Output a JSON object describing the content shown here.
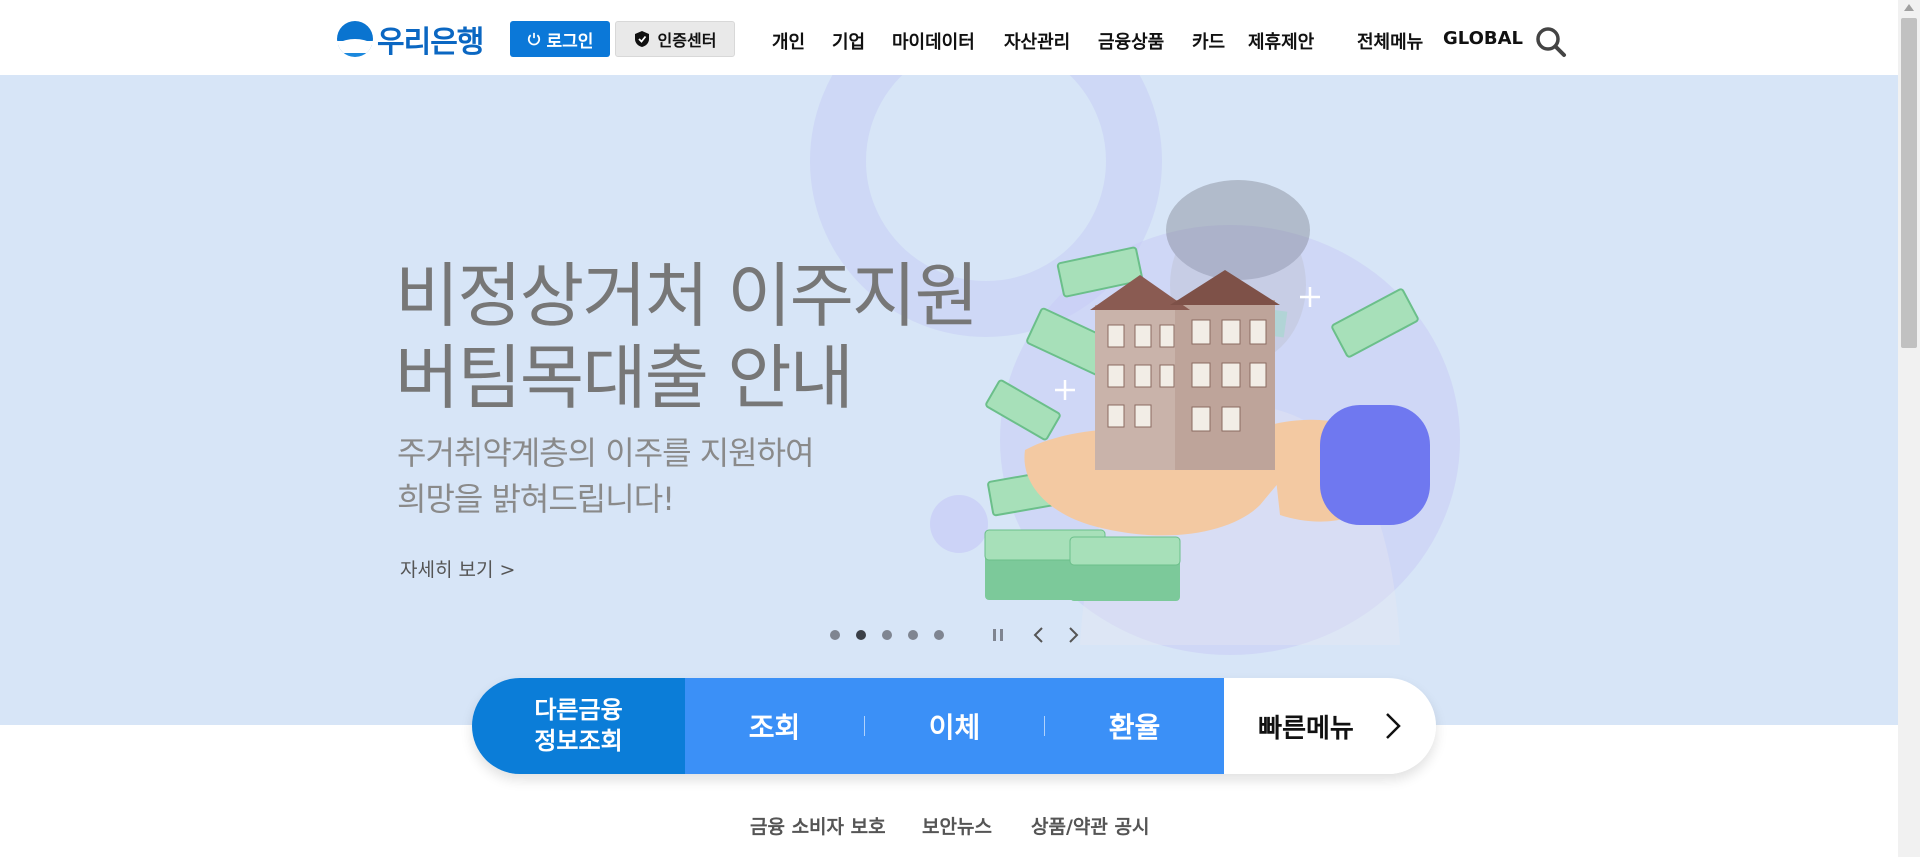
{
  "header": {
    "logo_text": "우리은행",
    "login_label": "로그인",
    "cert_label": "인증센터",
    "nav": [
      "개인",
      "기업",
      "마이데이터",
      "자산관리",
      "금융상품",
      "카드",
      "제휴제안"
    ],
    "all_menu": "전체메뉴",
    "global": "GLOBAL"
  },
  "hero": {
    "title_line1": "비정상거처 이주지원",
    "title_line2": "버팀목대출 안내",
    "subtitle_line1": "주거취약계층의 이주를 지원하여",
    "subtitle_line2": "희망을 밝혀드립니다!",
    "more_label": "자세히 보기 >",
    "slides_total": 5,
    "slide_active": 2
  },
  "quickbar": {
    "other_line1": "다른금융",
    "other_line2": "정보조회",
    "items": [
      "조회",
      "이체",
      "환율"
    ],
    "quick_menu": "빠른메뉴"
  },
  "footer_links": [
    "금융 소비자 보호",
    "보안뉴스",
    "상품/약관 공시"
  ],
  "colors": {
    "brand_blue": "#0b78d8",
    "quickbar_blue": "#3b90f7",
    "hero_bg": "#d7e5f7"
  }
}
